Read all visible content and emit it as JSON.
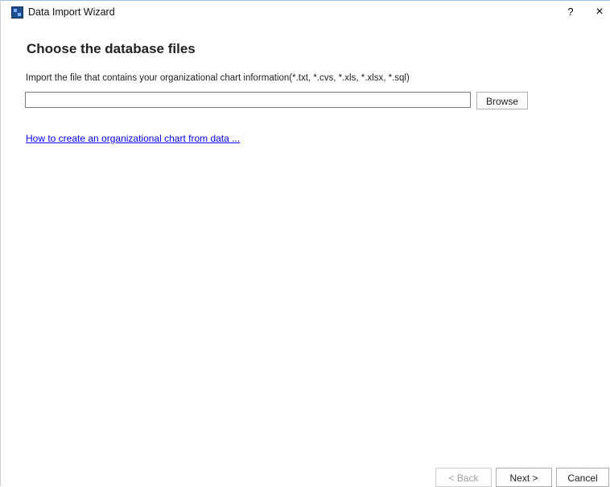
{
  "window": {
    "title": "Data Import Wizard",
    "help_label": "?",
    "close_label": "×"
  },
  "page": {
    "title": "Choose the database files",
    "instruction": "Import the file that contains your organizational chart information(*.txt, *.cvs, *.xls, *.xlsx, *.sql)",
    "file_input": {
      "value": "",
      "placeholder": ""
    },
    "browse_label": "Browse",
    "help_link": "How to create an organizational chart from data ..."
  },
  "footer": {
    "back_label": "< Back",
    "next_label": "Next >",
    "cancel_label": "Cancel"
  },
  "colors": {
    "link": "#0000ee",
    "title_border": "#9fc3e0",
    "app_icon": "#1f4e8c"
  }
}
